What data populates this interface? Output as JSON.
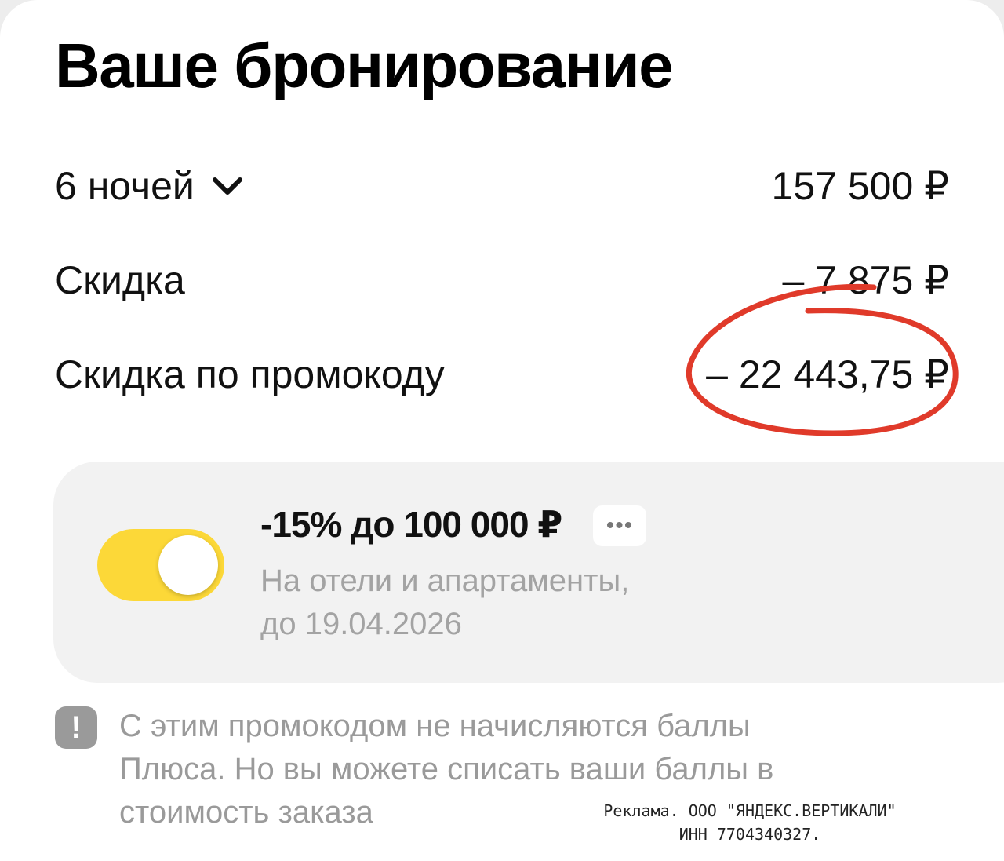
{
  "header": {
    "title": "Ваше бронирование"
  },
  "summary": {
    "nights_label": "6 ночей",
    "nights_value": "157 500 ₽",
    "discount_label": "Скидка",
    "discount_value": "– 7 875 ₽",
    "promo_label": "Скидка по промокоду",
    "promo_value": "– 22 443,75 ₽",
    "annotation_color": "#e03a2a"
  },
  "promo_offer": {
    "toggle_on": true,
    "toggle_color": "#fcd838",
    "title": "-15% до 100 000 ₽",
    "more_label": "•••",
    "subtitle_line1": "На отели и апартаменты,",
    "subtitle_line2": "до 19.04.2026"
  },
  "notice": {
    "icon_label": "!",
    "line1": "С этим промокодом не начисляются баллы",
    "line2": "Плюса. Но вы можете списать ваши баллы в",
    "line3": "стоимость заказа"
  },
  "ad": {
    "line1": "Реклама. ООО \"ЯНДЕКС.ВЕРТИКАЛИ\"",
    "line2": "ИНН 7704340327."
  }
}
